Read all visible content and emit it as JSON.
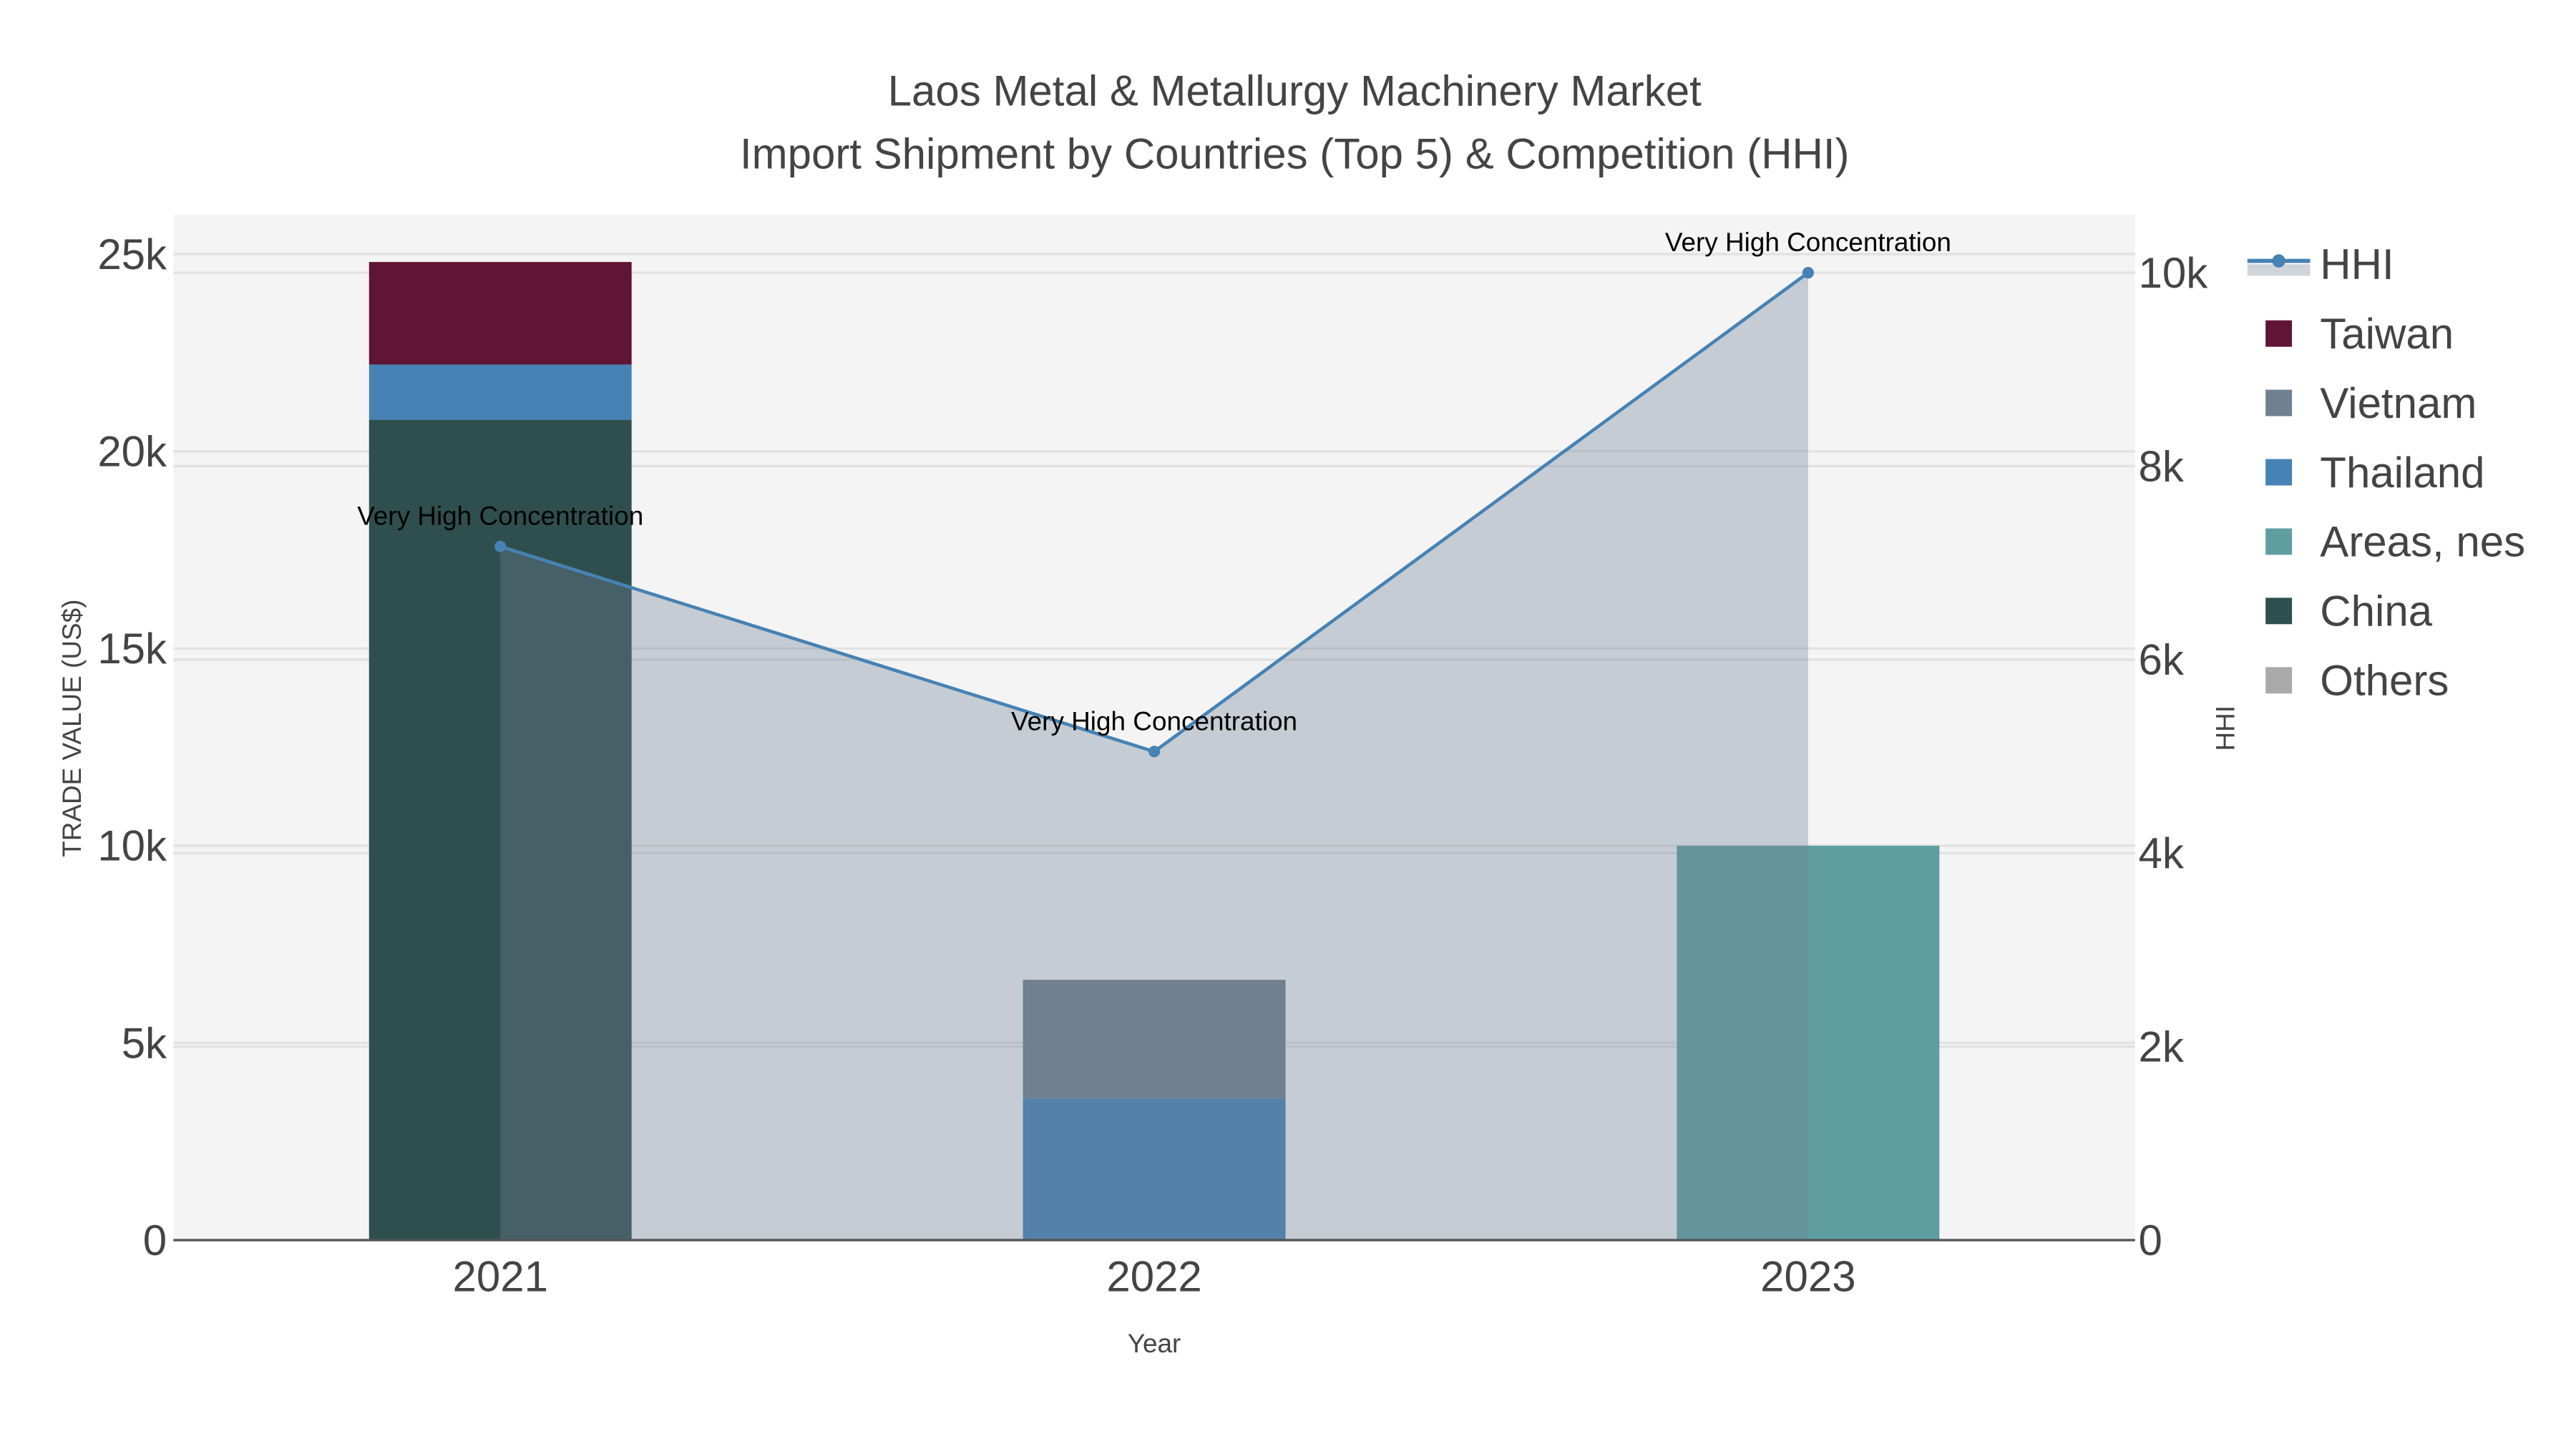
{
  "chart_data": {
    "type": "bar",
    "title_line1": "Laos Metal & Metallurgy Machinery Market",
    "title_line2": "Import Shipment by Countries (Top 5) & Competition (HHI)",
    "xlabel": "Year",
    "ylabel": "TRADE VALUE (US$)",
    "y2label": "HHI",
    "categories": [
      "2021",
      "2022",
      "2023"
    ],
    "ylim": [
      0,
      26000
    ],
    "yticks": [
      0,
      5000,
      10000,
      15000,
      20000,
      25000
    ],
    "ytick_labels": [
      "0",
      "5k",
      "10k",
      "15k",
      "20k",
      "25k"
    ],
    "y2lim": [
      0,
      10600
    ],
    "y2ticks": [
      0,
      2000,
      4000,
      6000,
      8000,
      10000
    ],
    "y2tick_labels": [
      "0",
      "2k",
      "4k",
      "6k",
      "8k",
      "10k"
    ],
    "barmode": "stack",
    "series": [
      {
        "name": "China",
        "color": "#2f4f4f",
        "values": [
          20800,
          0,
          0
        ]
      },
      {
        "name": "Areas, nes",
        "color": "#5f9ea0",
        "values": [
          0,
          0,
          10000
        ]
      },
      {
        "name": "Thailand",
        "color": "#4682b4",
        "values": [
          1400,
          3600,
          0
        ]
      },
      {
        "name": "Vietnam",
        "color": "#708090",
        "values": [
          0,
          3000,
          0
        ]
      },
      {
        "name": "Taiwan",
        "color": "#601535",
        "values": [
          2600,
          0,
          0
        ]
      },
      {
        "name": "Others",
        "color": "#aaaaaa",
        "values": [
          0,
          0,
          0
        ]
      }
    ],
    "hhi": {
      "name": "HHI",
      "color": "#4682b4",
      "fill": "rgba(112,128,150,0.35)",
      "values": [
        7170,
        5050,
        10000
      ],
      "annotations": [
        "Very High Concentration",
        "Very High Concentration",
        "Very High Concentration"
      ]
    },
    "legend_order": [
      "HHI",
      "Taiwan",
      "Vietnam",
      "Thailand",
      "Areas, nes",
      "China",
      "Others"
    ],
    "legend_placement": "right",
    "grid": true
  }
}
